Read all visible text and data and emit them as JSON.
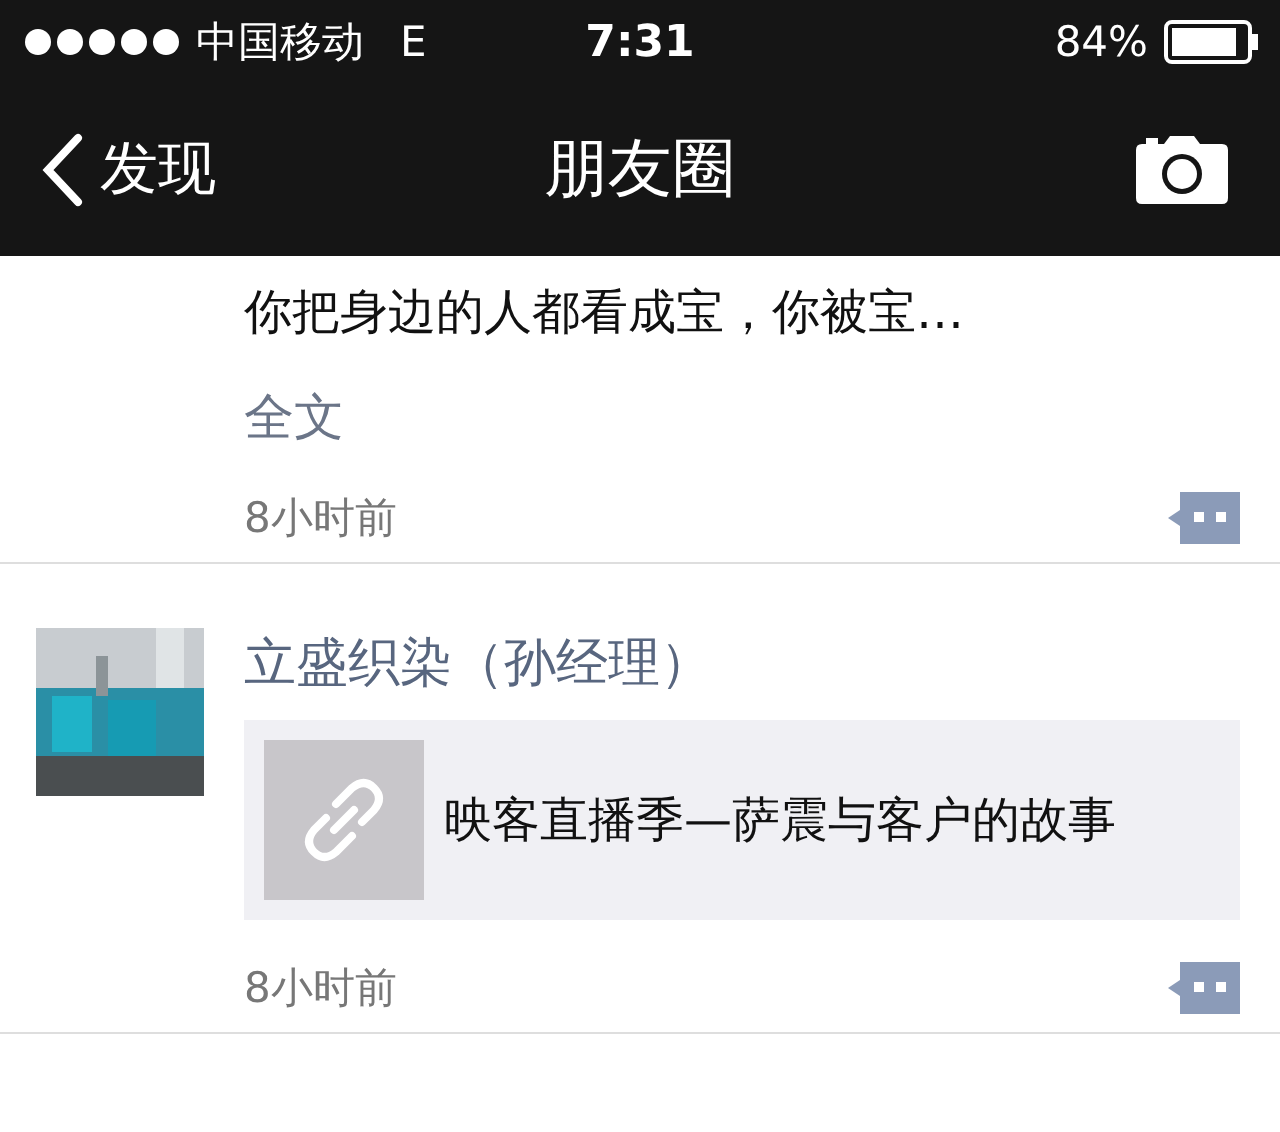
{
  "status_bar": {
    "carrier": "中国移动",
    "network": "E",
    "time": "7:31",
    "battery": "84%"
  },
  "nav_bar": {
    "back": "发现",
    "title": "朋友圈"
  },
  "posts": [
    {
      "text": "你把身边的人都看成宝，你被宝…",
      "expand": "全文",
      "time": "8小时前"
    },
    {
      "author": "立盛织染（孙经理）",
      "link": {
        "title": "映客直播季—萨震与客户的故事"
      },
      "time": "8小时前"
    }
  ]
}
